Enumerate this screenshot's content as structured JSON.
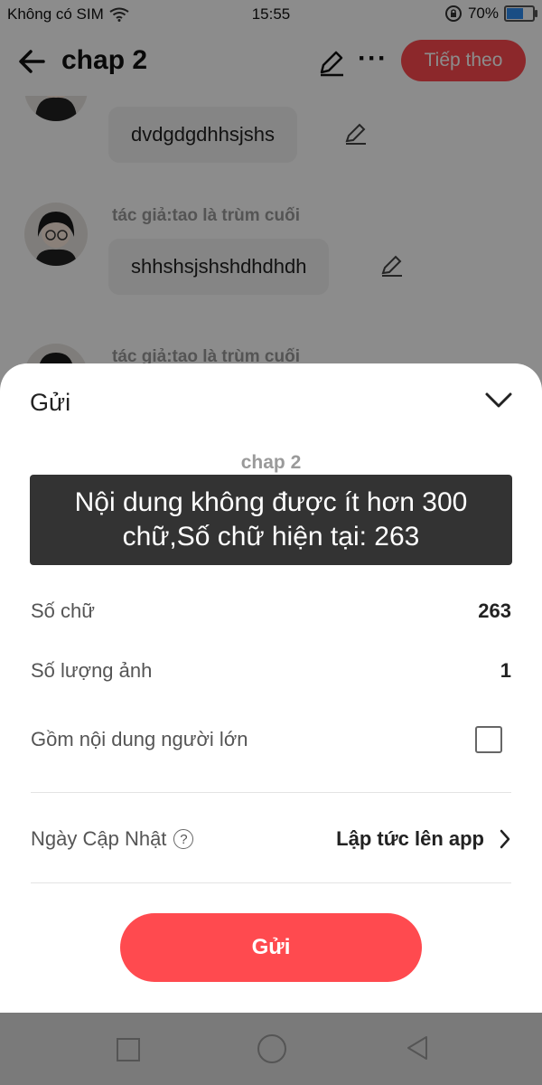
{
  "status_bar": {
    "carrier": "Không có SIM",
    "time": "15:55",
    "battery": "70%",
    "battery_level": 0.7
  },
  "header": {
    "title": "chap 2",
    "next_label": "Tiếp theo"
  },
  "messages": [
    {
      "author": "",
      "text": "dvdgdgdhhsjshs"
    },
    {
      "author": "tác giả:tao là trùm cuối",
      "text": "shhshsjshshdhdhdh"
    },
    {
      "author": "tác giả:tao là trùm cuối",
      "text": ""
    }
  ],
  "sheet": {
    "title": "Gửi",
    "chapter_name": "chap 2",
    "word_count_label": "Số chữ",
    "word_count_value": "263",
    "image_count_label": "Số lượng ảnh",
    "image_count_value": "1",
    "adult_label": "Gồm nội dung người lớn",
    "adult_checked": false,
    "update_date_label": "Ngày Cập Nhật",
    "update_date_help": "?",
    "update_date_value": "Lập tức lên app",
    "send_label": "Gửi"
  },
  "toast": {
    "line1": "Nội dung không được ít hơn 300",
    "line2": "chữ,Số chữ hiện tại: 263"
  },
  "colors": {
    "accent": "#ff4a4f",
    "toast_bg": "#333333"
  }
}
